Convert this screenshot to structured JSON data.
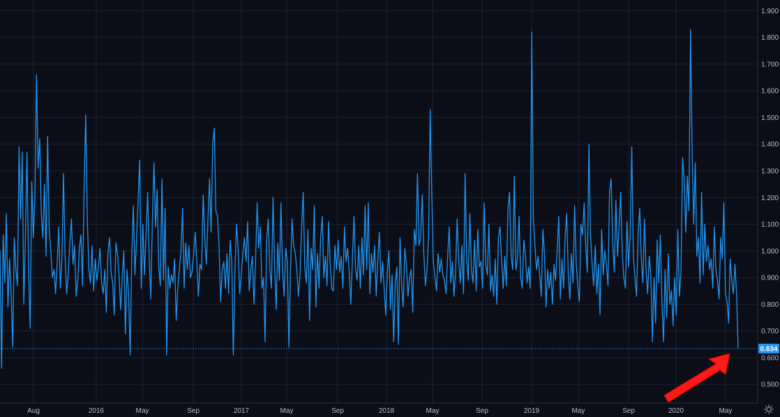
{
  "colors": {
    "background": "#0c0e17",
    "grid": "#1d2130",
    "axis_text": "#b8bcc8",
    "series": "#2196f3",
    "price_tag": "#2196f3",
    "arrow": "#ff1a1a"
  },
  "chart_data": {
    "type": "line",
    "title": "",
    "xlabel": "",
    "ylabel": "",
    "ylim": [
      0.43,
      1.94
    ],
    "y_ticks": [
      "0.500",
      "0.600",
      "0.700",
      "0.800",
      "0.900",
      "1.000",
      "1.100",
      "1.200",
      "1.300",
      "1.400",
      "1.500",
      "1.600",
      "1.700",
      "1.800",
      "1.900"
    ],
    "x_ticks": [
      "Aug",
      "2016",
      "May",
      "Sep",
      "2017",
      "May",
      "Sep",
      "2018",
      "May",
      "Sep",
      "2019",
      "May",
      "Sep",
      "2020",
      "May"
    ],
    "grid": true,
    "last_value": "0.634",
    "annotation": "red-arrow-pointing-at-last-value",
    "series": [
      {
        "values": [
          1.0,
          0.56,
          1.06,
          0.88,
          1.14,
          0.79,
          0.97,
          0.84,
          0.64,
          1.05,
          0.93,
          0.87,
          1.39,
          1.12,
          1.37,
          0.8,
          1.05,
          1.37,
          0.93,
          0.71,
          1.26,
          1.05,
          1.2,
          1.66,
          1.31,
          1.42,
          1.14,
          1.05,
          1.25,
          0.98,
          1.43,
          1.08,
          1.0,
          0.9,
          0.93,
          0.84,
          0.95,
          1.09,
          0.86,
          0.97,
          1.29,
          0.98,
          0.84,
          0.91,
          1.03,
          1.12,
          0.95,
          1.02,
          0.83,
          0.89,
          1.01,
          1.06,
          0.87,
          1.24,
          1.51,
          1.12,
          0.93,
          0.88,
          1.02,
          0.85,
          0.97,
          0.89,
          0.94,
          1.01,
          0.88,
          0.84,
          0.93,
          0.77,
          0.99,
          1.05,
          0.92,
          0.88,
          0.76,
          1.03,
          0.99,
          0.91,
          0.78,
          0.9,
          1.0,
          0.69,
          0.93,
          0.84,
          0.61,
          0.98,
          1.17,
          0.91,
          1.04,
          1.19,
          1.34,
          0.86,
          1.1,
          0.91,
          1.06,
          1.22,
          0.97,
          0.82,
          1.12,
          1.33,
          1.09,
          1.23,
          0.94,
          0.87,
          1.27,
          0.89,
          1.16,
          0.61,
          0.94,
          0.86,
          0.91,
          0.88,
          0.97,
          0.74,
          0.86,
          0.93,
          1.0,
          1.16,
          0.86,
          1.03,
          0.93,
          1.02,
          0.9,
          0.92,
          0.99,
          1.07,
          0.96,
          0.83,
          0.95,
          0.93,
          1.21,
          1.05,
          0.95,
          1.12,
          1.27,
          1.07,
          1.4,
          1.46,
          1.15,
          1.13,
          1.02,
          0.81,
          0.93,
          0.96,
          0.86,
          0.99,
          0.84,
          1.04,
          0.96,
          0.61,
          0.92,
          1.1,
          1.01,
          0.84,
          0.91,
          0.99,
          1.05,
          0.96,
          1.11,
          0.85,
          0.93,
          0.98,
          0.8,
          0.96,
          1.18,
          1.01,
          1.09,
          0.86,
          0.9,
          0.66,
          1.04,
          1.12,
          0.93,
          0.86,
          1.2,
          0.94,
          0.78,
          1.03,
          0.89,
          1.18,
          0.93,
          0.83,
          1.01,
          0.96,
          0.64,
          0.92,
          1.12,
          1.02,
          0.99,
          0.93,
          0.83,
          0.91,
          1.09,
          1.22,
          0.94,
          0.88,
          1.08,
          0.74,
          1.01,
          0.93,
          1.17,
          0.79,
          0.99,
          0.86,
          1.05,
          1.13,
          0.9,
          0.98,
          0.87,
          1.11,
          0.95,
          0.86,
          0.85,
          1.02,
          0.93,
          1.04,
          0.92,
          0.98,
          0.86,
          1.09,
          0.96,
          1.01,
          0.92,
          0.8,
          0.97,
          1.13,
          0.93,
          0.89,
          1.02,
          0.86,
          1.05,
          0.91,
          1.17,
          0.93,
          1.18,
          0.84,
          0.99,
          0.92,
          1.02,
          0.83,
          0.97,
          1.07,
          0.88,
          0.96,
          0.86,
          0.76,
          0.92,
          1.0,
          0.78,
          0.91,
          0.66,
          0.88,
          0.94,
          0.65,
          1.05,
          0.87,
          0.79,
          1.01,
          0.95,
          0.83,
          0.9,
          0.93,
          0.77,
          1.08,
          1.02,
          1.29,
          1.02,
          1.05,
          1.21,
          0.99,
          0.87,
          0.93,
          1.06,
          1.53,
          1.21,
          0.96,
          0.9,
          0.85,
          0.99,
          0.92,
          0.97,
          0.91,
          0.89,
          0.84,
          0.98,
          1.09,
          0.88,
          0.96,
          0.83,
          0.92,
          1.12,
          0.96,
          0.88,
          1.02,
          0.84,
          1.29,
          0.97,
          0.89,
          1.14,
          0.93,
          0.88,
          1.04,
          0.85,
          1.08,
          0.94,
          0.96,
          0.86,
          1.18,
          0.95,
          0.91,
          1.1,
          0.85,
          0.91,
          0.83,
          0.97,
          0.8,
          1.05,
          1.09,
          0.96,
          0.86,
          0.98,
          0.87,
          1.16,
          1.22,
          0.98,
          0.93,
          1.28,
          0.93,
          0.97,
          1.13,
          0.9,
          0.86,
          1.04,
          0.99,
          0.88,
          0.94,
          0.86,
          1.82,
          1.12,
          1.02,
          0.93,
          0.98,
          0.91,
          0.83,
          1.08,
          0.99,
          0.79,
          0.93,
          0.86,
          0.92,
          0.8,
          0.95,
          0.89,
          1.0,
          1.13,
          0.82,
          0.97,
          0.86,
          1.05,
          1.14,
          0.91,
          0.82,
          0.99,
          0.88,
          1.17,
          0.95,
          0.87,
          0.81,
          1.1,
          1.06,
          1.18,
          1.02,
          0.92,
          1.4,
          1.06,
          0.95,
          0.87,
          1.02,
          0.84,
          0.95,
          0.76,
          1.08,
          0.91,
          1.0,
          0.95,
          0.87,
          1.22,
          1.27,
          1.03,
          0.92,
          1.19,
          0.98,
          1.09,
          1.22,
          0.99,
          0.9,
          0.86,
          1.11,
          0.94,
          1.06,
          1.39,
          0.98,
          0.9,
          0.83,
          1.07,
          1.16,
          0.97,
          0.88,
          1.12,
          0.93,
          0.84,
          0.98,
          0.91,
          0.66,
          0.9,
          0.73,
          1.04,
          0.88,
          1.06,
          0.8,
          0.66,
          0.93,
          0.75,
          0.99,
          0.8,
          0.85,
          0.72,
          0.9,
          0.76,
          1.08,
          0.83,
          0.92,
          1.35,
          1.27,
          1.07,
          1.28,
          1.15,
          1.83,
          1.38,
          1.1,
          1.33,
          0.98,
          1.05,
          0.88,
          1.22,
          0.91,
          1.1,
          0.96,
          1.02,
          0.93,
          0.97,
          0.86,
          1.09,
          0.93,
          0.89,
          0.82,
          1.05,
          0.97,
          1.18,
          0.84,
          0.81,
          0.73,
          0.97,
          0.89,
          0.84,
          0.95,
          0.84,
          0.634
        ]
      }
    ]
  }
}
